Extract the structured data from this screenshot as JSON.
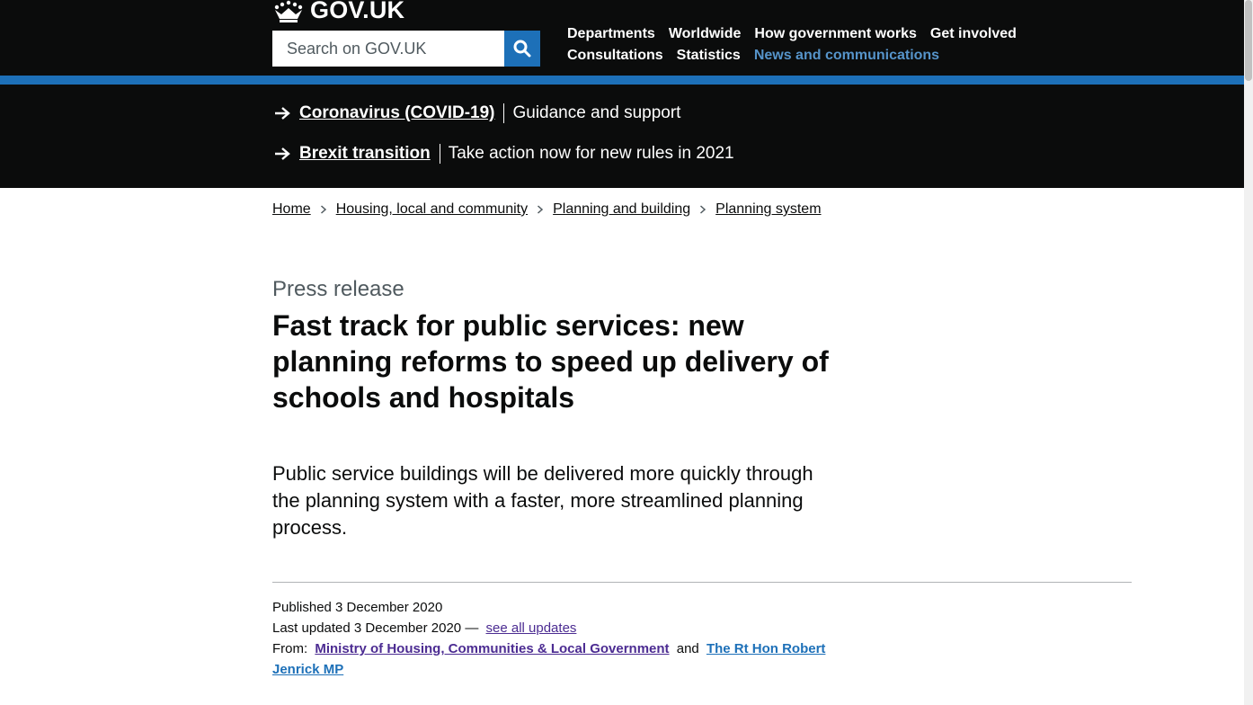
{
  "header": {
    "logo_text": "GOV.UK",
    "search": {
      "placeholder": "Search on GOV.UK"
    },
    "nav": [
      [
        "Departments",
        "Worldwide",
        "How government works",
        "Get involved"
      ],
      [
        "Consultations",
        "Statistics",
        "News and communications"
      ]
    ],
    "active_nav": "News and communications",
    "colors": {
      "header_bg": "#0b0c0c",
      "accent_blue": "#1d70b8",
      "active_link": "#5694ca"
    }
  },
  "banner": {
    "items": [
      {
        "link": "Coronavirus (COVID-19)",
        "description": "Guidance and support"
      },
      {
        "link": "Brexit transition",
        "description": "Take action now for new rules in 2021"
      }
    ]
  },
  "breadcrumb": [
    "Home",
    "Housing, local and community",
    "Planning and building",
    "Planning system"
  ],
  "page": {
    "eyebrow": "Press release",
    "title": "Fast track for public services: new planning reforms to speed up delivery of schools and hospitals",
    "lede": "Public service buildings will be delivered more quickly through the planning system with a faster, more streamlined planning process."
  },
  "meta": {
    "published": "Published 3 December 2020",
    "last_updated": "Last updated 3 December 2020 —",
    "see_all_updates": "see all updates",
    "from_label": "From:",
    "org": "Ministry of Housing, Communities & Local Government",
    "and": "and",
    "person": "The Rt Hon Robert Jenrick MP"
  }
}
